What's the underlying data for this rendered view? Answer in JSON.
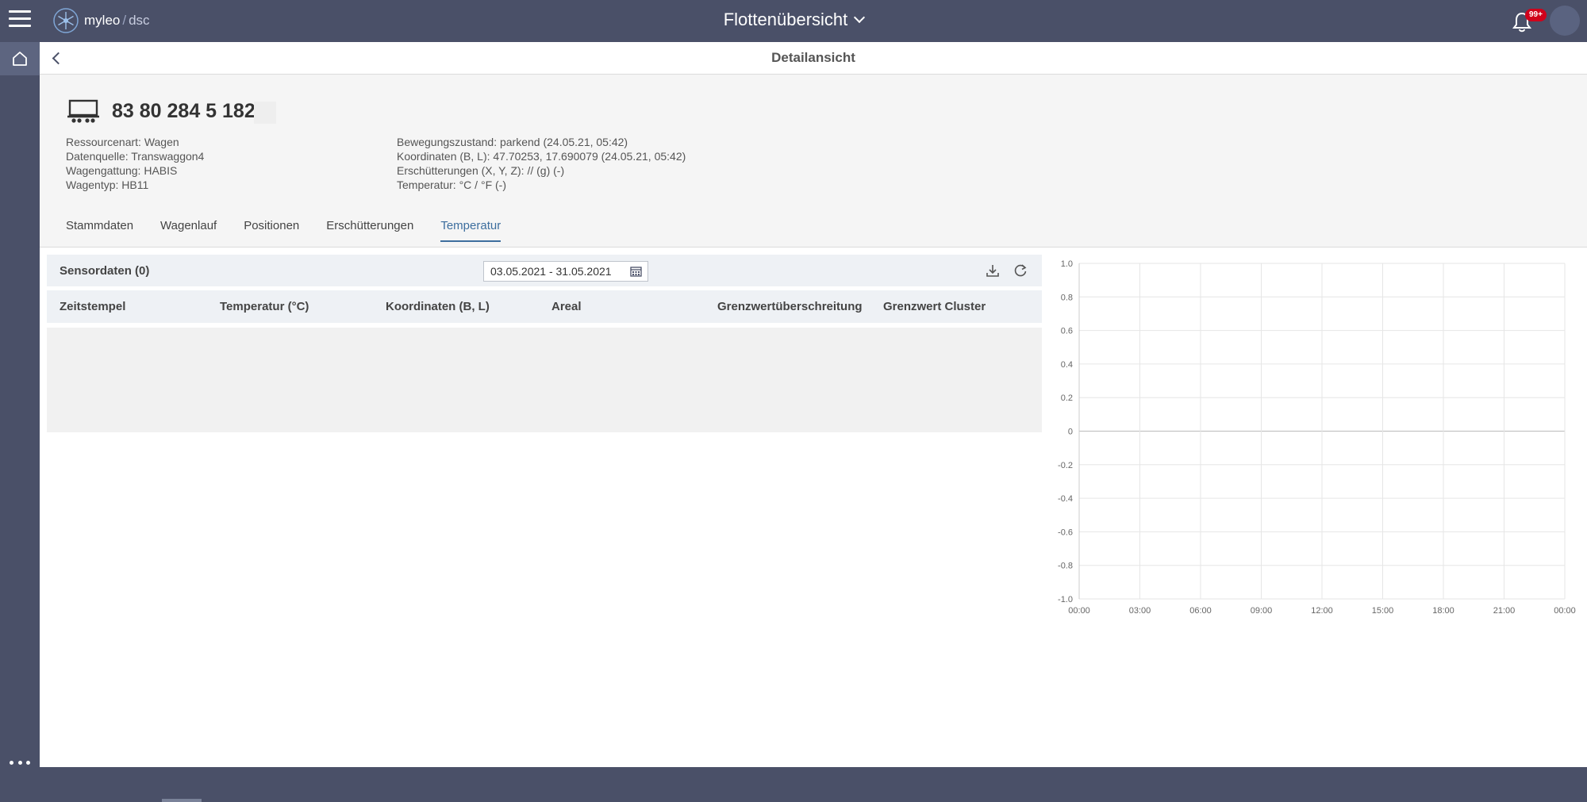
{
  "topbar": {
    "logo_brand": "myleo",
    "logo_sep": "/",
    "logo_product": "dsc",
    "title": "Flottenübersicht",
    "notification_badge": "99+"
  },
  "subheader": {
    "title": "Detailansicht"
  },
  "wagon": {
    "id": "83 80 284 5 182",
    "info_left": [
      "Ressourcenart: Wagen",
      "Datenquelle: Transwaggon4",
      "Wagengattung: HABIS",
      "Wagentyp: HB11"
    ],
    "info_right": [
      "Bewegungszustand: parkend (24.05.21, 05:42)",
      "Koordinaten (B, L): 47.70253, 17.690079 (24.05.21, 05:42)",
      "Erschütterungen (X, Y, Z): // (g) (-)",
      "Temperatur: °C / °F (-)"
    ]
  },
  "tabs": [
    {
      "label": "Stammdaten",
      "active": false
    },
    {
      "label": "Wagenlauf",
      "active": false
    },
    {
      "label": "Positionen",
      "active": false
    },
    {
      "label": "Erschütterungen",
      "active": false
    },
    {
      "label": "Temperatur",
      "active": true
    }
  ],
  "sensor": {
    "title": "Sensordaten (0)",
    "date_range": "03.05.2021 - 31.05.2021",
    "columns": [
      "Zeitstempel",
      "Temperatur (°C)",
      "Koordinaten (B, L)",
      "Areal",
      "Grenzwertüberschreitung",
      "Grenzwert Cluster"
    ],
    "rows": []
  },
  "icons": {
    "menu": "hamburger-menu-icon",
    "home": "home-icon",
    "more": "more-dots-icon",
    "back": "chevron-left-icon",
    "notifications": "bell-icon",
    "wagon": "wagon-icon",
    "calendar": "calendar-icon",
    "download": "download-icon",
    "refresh": "refresh-icon"
  },
  "colors": {
    "header_bg": "#4a5068",
    "accent": "#3d6e9e",
    "badge": "#d0021b"
  },
  "chart_data": {
    "type": "line",
    "x_ticks": [
      "00:00",
      "03:00",
      "06:00",
      "09:00",
      "12:00",
      "15:00",
      "18:00",
      "21:00",
      "00:00"
    ],
    "y_ticks": [
      "1.0",
      "0.8",
      "0.6",
      "0.4",
      "0.2",
      "0",
      "-0.2",
      "-0.4",
      "-0.6",
      "-0.8",
      "-1.0"
    ],
    "ylim": [
      -1.0,
      1.0
    ],
    "series": [],
    "grid": true
  }
}
